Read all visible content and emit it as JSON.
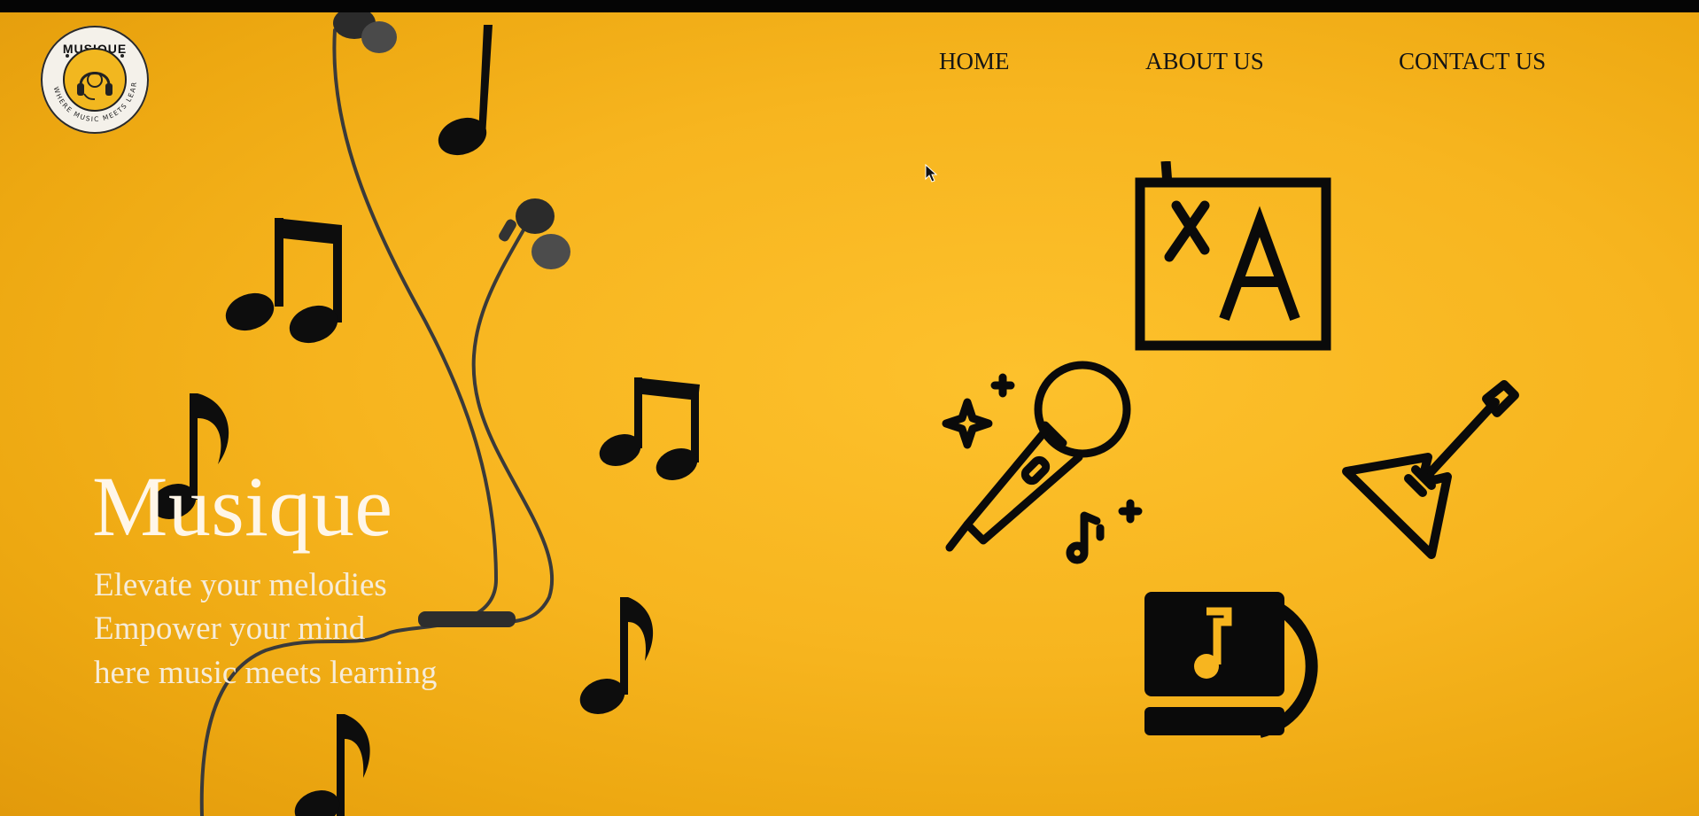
{
  "logo": {
    "title": "MUSIQUE",
    "ring_text": "WHERE MUSIC MEETS LEARNING",
    "icon": "headphones-icon"
  },
  "nav": {
    "home": "HOME",
    "about": "ABOUT US",
    "contact": "CONTACT US"
  },
  "hero": {
    "title": "Musique",
    "tagline": [
      "Elevate your melodies",
      "Empower your mind",
      "here music meets learning"
    ]
  },
  "icons": [
    "translate-icon",
    "microphone-icon",
    "electric-guitar-icon",
    "music-album-icon"
  ],
  "colors": {
    "background": "#f7b51f",
    "icon": "#0a0a0a",
    "hero_text": "#fff6e8"
  }
}
